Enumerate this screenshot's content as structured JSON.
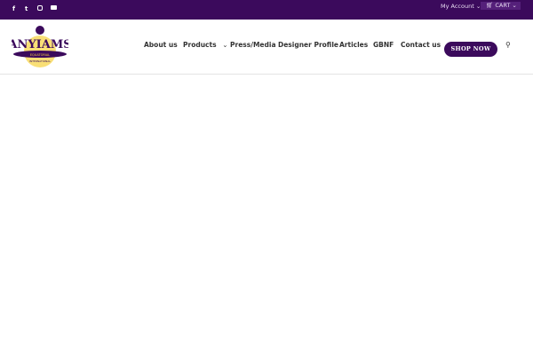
{
  "topbar": {
    "social": [
      "facebook-icon",
      "twitter-icon",
      "instagram-icon",
      "youtube-icon"
    ],
    "my_account": "My Account",
    "cart": "CART"
  },
  "logo": {
    "name": "ANYIAMS",
    "line2": "EQUATORIAL",
    "line3": "INTERNATIONAL"
  },
  "nav": {
    "items": [
      "About us",
      "Products",
      "Press/Media",
      "Designer Profile",
      "Articles",
      "GBNF",
      "Contact us"
    ],
    "shop_now": "SHOP NOW"
  },
  "colors": {
    "brand": "#3b0a5c"
  }
}
